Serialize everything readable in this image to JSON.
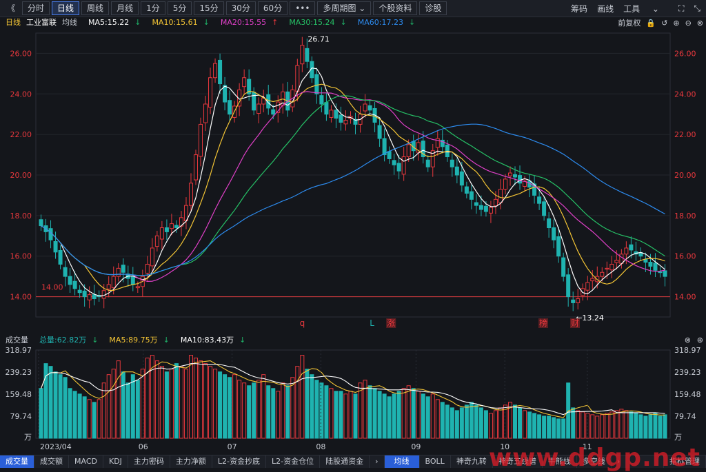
{
  "toolbar": {
    "back": "《",
    "periods": [
      "分时",
      "日线",
      "周线",
      "月线",
      "1分",
      "5分",
      "15分",
      "30分",
      "60分"
    ],
    "active_period": "日线",
    "more": "•••",
    "multi": "多周期图",
    "profile": "个股资料",
    "diagnose": "诊股",
    "chips": "筹码",
    "draw": "画线",
    "tools": "工具"
  },
  "legend": {
    "period": "日线",
    "name": "工业富联",
    "ma_label": "均线",
    "ma5": "MA5:15.22",
    "ma10": "MA10:15.61",
    "ma20": "MA20:15.55",
    "ma30": "MA30:15.24",
    "ma60": "MA60:17.23",
    "adjust": "前复权"
  },
  "vol_legend": {
    "title": "成交量",
    "total": "总量:62.82万",
    "ma5": "MA5:89.75万",
    "ma10": "MA10:83.43万"
  },
  "colors": {
    "up": "#e8383d",
    "down": "#1fb3b0",
    "ma5": "#ffffff",
    "ma10": "#f4c535",
    "ma20": "#e040c8",
    "ma30": "#26c267",
    "ma60": "#2d8cf0",
    "hline": "#d8393d"
  },
  "chart_data": {
    "type": "candlestick",
    "ylim": [
      13,
      27
    ],
    "price_ticks": [
      "14.00",
      "16.00",
      "18.00",
      "20.00",
      "22.00",
      "24.00",
      "26.00"
    ],
    "vol_ticks": [
      "79.74",
      "159.48",
      "239.23",
      "318.97"
    ],
    "vol_unit": "万",
    "x_labels": [
      "2023/04",
      "06",
      "07",
      "08",
      "09",
      "10",
      "11"
    ],
    "annotations": {
      "high": "26.71",
      "low": "←13.24",
      "line_level": "14.00"
    },
    "markers": [
      "q",
      "L",
      "涨",
      "榜",
      "财"
    ],
    "closes": [
      17.5,
      17.2,
      16.8,
      16.2,
      15.6,
      15.0,
      14.6,
      14.4,
      14.2,
      14.0,
      14.1,
      13.9,
      14.0,
      14.3,
      14.6,
      15.0,
      15.4,
      15.2,
      14.9,
      14.6,
      14.5,
      15.0,
      15.6,
      16.4,
      17.0,
      17.4,
      17.2,
      17.6,
      17.4,
      17.9,
      18.5,
      19.6,
      21.0,
      22.5,
      23.5,
      24.8,
      25.5,
      24.5,
      23.6,
      23.0,
      23.4,
      24.2,
      24.8,
      24.0,
      23.2,
      23.5,
      23.8,
      23.3,
      23.0,
      23.6,
      24.1,
      23.2,
      24.2,
      25.4,
      26.4,
      25.6,
      24.8,
      24.0,
      23.5,
      23.0,
      23.2,
      22.8,
      22.6,
      22.7,
      22.9,
      22.5,
      23.0,
      23.5,
      23.2,
      22.6,
      21.8,
      21.0,
      20.8,
      20.5,
      20.2,
      20.9,
      21.5,
      21.2,
      21.6,
      20.9,
      20.4,
      21.2,
      21.8,
      21.4,
      20.9,
      20.4,
      20.0,
      19.5,
      19.1,
      18.8,
      18.5,
      18.3,
      18.2,
      18.4,
      18.8,
      19.3,
      19.8,
      20.1,
      19.9,
      19.6,
      19.7,
      19.4,
      19.0,
      18.6,
      18.0,
      17.4,
      16.8,
      16.0,
      15.0,
      14.0,
      13.7,
      13.9,
      14.4,
      14.7,
      14.9,
      15.0,
      15.2,
      15.4,
      15.6,
      15.8,
      16.1,
      16.4,
      16.3,
      16.1,
      16.0,
      15.7,
      15.5,
      15.3,
      15.2,
      15.0
    ],
    "volumes": [
      180,
      270,
      260,
      240,
      230,
      220,
      180,
      170,
      160,
      150,
      140,
      130,
      140,
      200,
      230,
      250,
      280,
      240,
      200,
      230,
      210,
      250,
      290,
      300,
      280,
      260,
      240,
      250,
      270,
      260,
      250,
      300,
      290,
      280,
      270,
      260,
      250,
      240,
      230,
      220,
      230,
      210,
      200,
      190,
      200,
      210,
      230,
      190,
      180,
      170,
      200,
      190,
      220,
      260,
      300,
      250,
      230,
      210,
      200,
      190,
      180,
      170,
      170,
      160,
      170,
      160,
      200,
      210,
      190,
      180,
      170,
      160,
      150,
      160,
      170,
      180,
      190,
      180,
      170,
      160,
      150,
      160,
      140,
      130,
      120,
      110,
      100,
      110,
      120,
      130,
      120,
      110,
      100,
      90,
      100,
      110,
      120,
      130,
      120,
      110,
      100,
      95,
      90,
      85,
      80,
      80,
      75,
      70,
      70,
      200,
      110,
      100,
      95,
      90,
      85,
      80,
      85,
      90,
      95,
      100,
      105,
      100,
      95,
      90,
      85,
      80,
      85,
      90,
      80,
      85
    ]
  },
  "bottom_tabs": [
    "成交量",
    "成交额",
    "MACD",
    "KDJ",
    "主力密码",
    "主力净额",
    "L2-资金抄底",
    "L2-资金仓位",
    "陆股通资金"
  ],
  "bottom_tabs_right": [
    "均线",
    "BOLL",
    "神奇九转",
    "神奇五线谱",
    "牛熊线",
    "多空线",
    "指标管理"
  ],
  "watermark": "www.ddgp.net"
}
